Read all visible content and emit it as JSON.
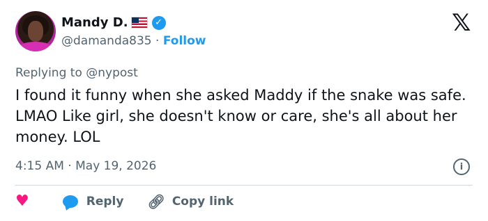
{
  "author": {
    "name": "Mandy D.",
    "handle": "@damanda835",
    "separator": "·",
    "follow_label": "Follow"
  },
  "platform_logo": "𝕏",
  "replying": {
    "prefix": "Replying to",
    "target": "@nypost"
  },
  "tweet": {
    "text": "I found it funny when she asked Maddy if the snake was safe. LMAO Like girl, she doesn't know or care, she's all about her money. LOL"
  },
  "meta": {
    "time": "4:15 AM",
    "separator": "·",
    "date": "May 19, 2026"
  },
  "actions": {
    "reply_label": "Reply",
    "copy_label": "Copy link"
  },
  "colors": {
    "accent": "#1d9bf0",
    "heart": "#f91880",
    "secondary_text": "#536471"
  },
  "icons": {
    "verified": "verified-badge-icon",
    "flag": "us-flag-icon",
    "info": "info-icon",
    "heart": "heart-icon",
    "reply": "reply-bubble-icon",
    "link": "link-icon"
  }
}
